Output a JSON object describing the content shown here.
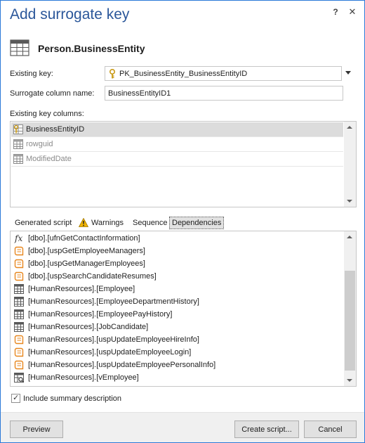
{
  "window": {
    "title": "Add surrogate key",
    "help_glyph": "?",
    "close_glyph": "✕"
  },
  "entity": {
    "name": "Person.BusinessEntity",
    "icon": "table-icon"
  },
  "form": {
    "existing_key_label": "Existing key:",
    "existing_key_value": "PK_BusinessEntity_BusinessEntityID",
    "surrogate_label": "Surrogate column name:",
    "surrogate_value": "BusinessEntityID1",
    "existing_key_columns_label": "Existing key columns:"
  },
  "key_columns": [
    {
      "name": "BusinessEntityID",
      "icon": "key-column-icon",
      "selected": true
    },
    {
      "name": "rowguid",
      "icon": "column-icon",
      "selected": false
    },
    {
      "name": "ModifiedDate",
      "icon": "column-icon",
      "selected": false
    }
  ],
  "tabs": [
    {
      "label": "Generated script"
    },
    {
      "label": "Warnings",
      "icon": "warning-icon"
    },
    {
      "label": "Sequence"
    },
    {
      "label": "Dependencies",
      "active": true
    }
  ],
  "dependencies": [
    {
      "name": "[dbo].[ufnGetContactInformation]",
      "icon": "function-icon"
    },
    {
      "name": "[dbo].[uspGetEmployeeManagers]",
      "icon": "procedure-icon"
    },
    {
      "name": "[dbo].[uspGetManagerEmployees]",
      "icon": "procedure-icon"
    },
    {
      "name": "[dbo].[uspSearchCandidateResumes]",
      "icon": "procedure-icon"
    },
    {
      "name": "[HumanResources].[Employee]",
      "icon": "table-icon"
    },
    {
      "name": "[HumanResources].[EmployeeDepartmentHistory]",
      "icon": "table-icon"
    },
    {
      "name": "[HumanResources].[EmployeePayHistory]",
      "icon": "table-icon"
    },
    {
      "name": "[HumanResources].[JobCandidate]",
      "icon": "table-icon"
    },
    {
      "name": "[HumanResources].[uspUpdateEmployeeHireInfo]",
      "icon": "procedure-icon"
    },
    {
      "name": "[HumanResources].[uspUpdateEmployeeLogin]",
      "icon": "procedure-icon"
    },
    {
      "name": "[HumanResources].[uspUpdateEmployeePersonalInfo]",
      "icon": "procedure-icon"
    },
    {
      "name": "[HumanResources].[vEmployee]",
      "icon": "view-icon"
    }
  ],
  "summary": {
    "label": "Include summary description",
    "checked": true
  },
  "buttons": {
    "preview": "Preview",
    "create_script": "Create script...",
    "cancel": "Cancel"
  },
  "colors": {
    "title": "#2b579a",
    "selection": "#dcdcdc",
    "procedure": "#e8871e"
  }
}
